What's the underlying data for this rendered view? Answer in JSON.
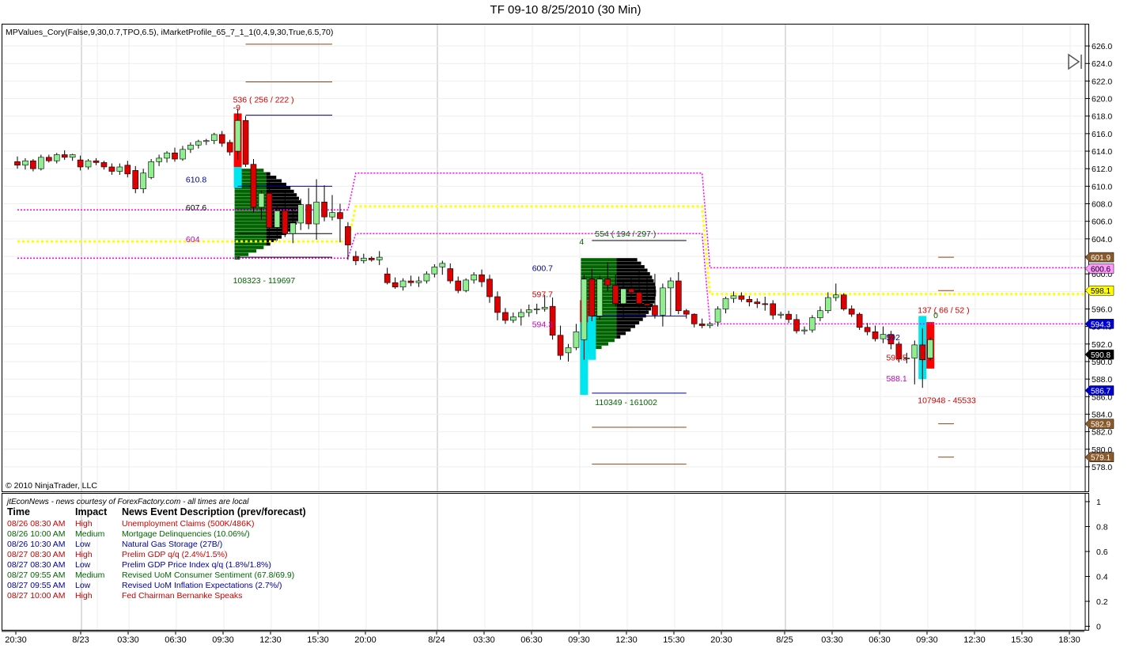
{
  "title": "TF 09-10  8/25/2010 (30 Min)",
  "indicator_label": "MPValues_Cory(False,9,30,0.7,TPO,6.5), iMarketProfile_65_7_1_1(0,4,9,30,True,6.5,70)",
  "copyright": "© 2010 NinjaTrader, LLC",
  "news": {
    "source": "jtEconNews - news courtesy of ForexFactory.com - all times are local",
    "headers": {
      "time": "Time",
      "impact": "Impact",
      "desc": "News Event Description (prev/forecast)"
    },
    "rows": [
      {
        "time": "08/26 08:30 AM",
        "impact": "High",
        "desc": "Unemployment Claims (500K/486K)",
        "color": "#cc0000"
      },
      {
        "time": "08/26 10:00 AM",
        "impact": "Medium",
        "desc": "Mortgage Delinquencies (10.06%/)",
        "color": "#006600"
      },
      {
        "time": "08/26 10:30 AM",
        "impact": "Low",
        "desc": "Natural Gas Storage (27B/)",
        "color": "#000099"
      },
      {
        "time": "08/27 08:30 AM",
        "impact": "High",
        "desc": "Prelim GDP q/q (2.4%/1.5%)",
        "color": "#cc0000"
      },
      {
        "time": "08/27 08:30 AM",
        "impact": "Low",
        "desc": "Prelim GDP Price Index q/q (1.8%/1.8%)",
        "color": "#000099"
      },
      {
        "time": "08/27 09:55 AM",
        "impact": "Medium",
        "desc": "Revised UoM Consumer Sentiment (67.8/69.9)",
        "color": "#006600"
      },
      {
        "time": "08/27 09:55 AM",
        "impact": "Low",
        "desc": "Revised UoM Inflation Expectations (2.7%/)",
        "color": "#000099"
      },
      {
        "time": "08/27 10:00 AM",
        "impact": "High",
        "desc": "Fed Chairman Bernanke Speaks",
        "color": "#cc0000"
      }
    ]
  },
  "chart_data": {
    "type": "candlestick",
    "title": "TF 09-10  8/25/2010 (30 Min)",
    "y_ticks": [
      "626.0",
      "624.0",
      "622.0",
      "620.0",
      "618.0",
      "616.0",
      "614.0",
      "612.0",
      "610.0",
      "608.0",
      "606.0",
      "604.0",
      "602.0",
      "600.0",
      "598.0",
      "596.0",
      "594.0",
      "592.0",
      "590.0",
      "588.0",
      "586.0",
      "584.0",
      "582.0",
      "580.0",
      "578.0"
    ],
    "ylim": [
      577,
      627
    ],
    "x_ticks": [
      "20:30",
      "8/23",
      "03:30",
      "06:30",
      "09:30",
      "12:30",
      "15:30",
      "20:00",
      "8/24",
      "03:30",
      "06:30",
      "09:30",
      "12:30",
      "15:30",
      "20:30",
      "8/25",
      "03:30",
      "06:30",
      "09:30",
      "12:30",
      "15:30",
      "18:30"
    ],
    "sub_ticks": [
      "1",
      "0.8",
      "0.6",
      "0.4",
      "0.2",
      "0"
    ],
    "candles": [
      [
        612.8,
        613.4,
        612.0,
        612.4
      ],
      [
        612.4,
        613.2,
        611.9,
        612.9
      ],
      [
        612.9,
        613.1,
        611.7,
        612.0
      ],
      [
        612.0,
        613.6,
        611.8,
        613.3
      ],
      [
        613.3,
        613.6,
        612.7,
        612.9
      ],
      [
        612.9,
        613.8,
        612.6,
        613.6
      ],
      [
        613.6,
        614.1,
        613.0,
        613.3
      ],
      [
        613.3,
        613.7,
        612.9,
        613.6
      ],
      [
        613.0,
        613.5,
        611.8,
        612.2
      ],
      [
        612.2,
        613.1,
        611.9,
        612.9
      ],
      [
        612.9,
        613.2,
        612.4,
        612.7
      ],
      [
        612.7,
        612.9,
        611.9,
        612.2
      ],
      [
        612.2,
        612.6,
        611.3,
        611.7
      ],
      [
        611.7,
        612.6,
        611.3,
        612.2
      ],
      [
        612.4,
        612.9,
        611.0,
        611.4
      ],
      [
        611.8,
        612.3,
        609.2,
        609.7
      ],
      [
        609.7,
        612.0,
        609.2,
        611.5
      ],
      [
        611.0,
        613.1,
        610.8,
        612.8
      ],
      [
        612.8,
        613.6,
        612.3,
        613.2
      ],
      [
        613.2,
        614.0,
        612.7,
        613.8
      ],
      [
        613.8,
        614.4,
        612.8,
        613.1
      ],
      [
        613.1,
        614.6,
        612.9,
        614.2
      ],
      [
        614.2,
        615.0,
        613.8,
        614.7
      ],
      [
        614.7,
        615.3,
        614.3,
        615.1
      ],
      [
        615.1,
        615.4,
        614.7,
        615.2
      ],
      [
        615.2,
        616.1,
        614.8,
        615.9
      ],
      [
        615.9,
        616.3,
        614.5,
        614.9
      ],
      [
        615.0,
        615.3,
        613.5,
        613.9
      ],
      [
        614.0,
        618.8,
        613.0,
        617.5
      ],
      [
        617.5,
        618.0,
        612.2,
        612.5
      ],
      [
        612.5,
        613.1,
        607.0,
        607.6
      ],
      [
        607.6,
        609.5,
        606.2,
        609.2
      ],
      [
        609.2,
        610.5,
        604.0,
        605.3
      ],
      [
        605.3,
        608.0,
        603.8,
        607.2
      ],
      [
        607.2,
        609.4,
        604.2,
        604.6
      ],
      [
        604.6,
        607.5,
        603.5,
        605.8
      ],
      [
        605.8,
        608.6,
        605.0,
        607.9
      ],
      [
        607.9,
        609.8,
        605.1,
        605.7
      ],
      [
        605.7,
        610.8,
        603.9,
        608.2
      ],
      [
        608.2,
        610.1,
        606.0,
        606.5
      ],
      [
        606.5,
        609.0,
        606.1,
        607.0
      ],
      [
        607.0,
        608.0,
        603.6,
        606.3
      ],
      [
        605.4,
        605.9,
        601.6,
        603.3
      ],
      [
        602.0,
        602.6,
        601.0,
        601.5
      ],
      [
        601.5,
        602.3,
        601.2,
        601.8
      ],
      [
        601.8,
        602.0,
        601.4,
        601.6
      ],
      [
        601.6,
        602.6,
        601.0,
        601.9
      ],
      [
        600.0,
        600.7,
        598.8,
        599.0
      ],
      [
        599.0,
        599.6,
        598.3,
        598.5
      ],
      [
        598.5,
        599.5,
        598.1,
        599.2
      ],
      [
        599.2,
        599.8,
        598.6,
        599.0
      ],
      [
        599.0,
        599.7,
        598.5,
        599.2
      ],
      [
        599.2,
        600.3,
        598.9,
        600.0
      ],
      [
        600.0,
        601.1,
        599.6,
        600.8
      ],
      [
        600.8,
        601.5,
        599.9,
        601.2
      ],
      [
        600.6,
        601.2,
        598.9,
        599.2
      ],
      [
        599.2,
        599.7,
        597.8,
        598.1
      ],
      [
        598.1,
        599.5,
        597.9,
        599.3
      ],
      [
        599.3,
        600.2,
        598.9,
        599.9
      ],
      [
        599.9,
        600.5,
        598.5,
        599.1
      ],
      [
        599.4,
        599.9,
        596.7,
        597.4
      ],
      [
        597.4,
        598.0,
        594.7,
        595.6
      ],
      [
        595.6,
        596.1,
        594.3,
        594.7
      ],
      [
        594.7,
        595.6,
        594.4,
        595.1
      ],
      [
        595.1,
        596.0,
        594.1,
        595.6
      ],
      [
        595.6,
        596.5,
        595.1,
        595.9
      ],
      [
        595.9,
        596.6,
        595.4,
        596.0
      ],
      [
        596.0,
        597.6,
        595.7,
        596.2
      ],
      [
        596.3,
        597.3,
        592.5,
        593.0
      ],
      [
        593.0,
        594.1,
        590.2,
        590.7
      ],
      [
        591.0,
        592.0,
        590.0,
        591.6
      ],
      [
        591.6,
        594.3,
        591.3,
        593.4
      ],
      [
        592.5,
        599.9,
        590.2,
        599.4
      ],
      [
        599.4,
        600.6,
        594.6,
        595.2
      ],
      [
        595.2,
        599.8,
        594.8,
        599.4
      ],
      [
        599.4,
        601.3,
        598.0,
        598.7
      ],
      [
        598.7,
        599.9,
        596.3,
        596.6
      ],
      [
        596.6,
        599.2,
        594.9,
        598.3
      ],
      [
        598.3,
        599.6,
        597.2,
        597.9
      ],
      [
        597.9,
        600.4,
        595.4,
        596.6
      ],
      [
        596.6,
        599.7,
        595.8,
        596.4
      ],
      [
        596.4,
        600.0,
        594.9,
        595.3
      ],
      [
        595.3,
        598.9,
        594.0,
        598.4
      ],
      [
        598.4,
        599.6,
        595.2,
        599.2
      ],
      [
        599.2,
        600.2,
        595.4,
        595.8
      ],
      [
        595.8,
        596.0,
        594.9,
        595.4
      ],
      [
        595.4,
        595.5,
        593.9,
        594.3
      ],
      [
        594.3,
        594.9,
        593.8,
        594.1
      ],
      [
        594.1,
        594.5,
        593.8,
        594.3
      ],
      [
        594.5,
        596.3,
        594.0,
        596.0
      ],
      [
        596.0,
        597.4,
        595.5,
        597.2
      ],
      [
        597.2,
        598.0,
        596.7,
        597.5
      ],
      [
        597.5,
        597.9,
        596.8,
        597.1
      ],
      [
        597.1,
        597.5,
        596.3,
        596.8
      ],
      [
        596.8,
        597.2,
        596.1,
        596.6
      ],
      [
        596.6,
        597.4,
        595.8,
        596.5
      ],
      [
        596.6,
        597.0,
        594.8,
        595.3
      ],
      [
        595.3,
        595.7,
        594.9,
        595.4
      ],
      [
        595.4,
        595.8,
        594.4,
        594.8
      ],
      [
        594.8,
        595.4,
        593.2,
        593.5
      ],
      [
        593.5,
        594.0,
        593.1,
        593.6
      ],
      [
        593.6,
        595.3,
        593.3,
        595.0
      ],
      [
        595.0,
        596.3,
        594.6,
        595.8
      ],
      [
        595.8,
        597.9,
        595.5,
        597.3
      ],
      [
        597.3,
        598.9,
        596.9,
        597.6
      ],
      [
        597.6,
        597.8,
        595.8,
        596.0
      ],
      [
        596.0,
        596.4,
        595.1,
        595.4
      ],
      [
        595.4,
        595.6,
        593.6,
        593.9
      ],
      [
        593.9,
        594.4,
        593.0,
        593.4
      ],
      [
        593.4,
        594.1,
        592.3,
        592.6
      ],
      [
        592.6,
        594.0,
        592.1,
        593.1
      ],
      [
        593.1,
        593.5,
        591.4,
        592.0
      ],
      [
        592.0,
        592.3,
        589.9,
        590.3
      ],
      [
        590.3,
        591.0,
        589.8,
        590.4
      ],
      [
        590.4,
        592.4,
        587.4,
        591.9
      ],
      [
        591.9,
        593.8,
        587.0,
        590.2
      ],
      [
        590.4,
        592.8,
        590.1,
        592.5
      ]
    ],
    "lines": [
      {
        "name": "upper band",
        "color": "#ff00ff",
        "style": "dotted",
        "values": [
          [
            0,
            607.3
          ],
          [
            42,
            607.3
          ],
          [
            43,
            611.5
          ],
          [
            87,
            611.5
          ],
          [
            88,
            600.7
          ],
          [
            122,
            600.7
          ]
        ]
      },
      {
        "name": "value area",
        "color": "#ffff00",
        "style": "dotted",
        "values": [
          [
            0,
            603.7
          ],
          [
            42,
            603.7
          ],
          [
            43,
            607.7
          ],
          [
            87,
            607.7
          ],
          [
            88,
            597.7
          ],
          [
            122,
            597.7
          ]
        ]
      },
      {
        "name": "lower band",
        "color": "#ff00ff",
        "style": "dotted",
        "values": [
          [
            0,
            601.8
          ],
          [
            42,
            601.8
          ],
          [
            43,
            604.6
          ],
          [
            87,
            604.6
          ],
          [
            88,
            594.3
          ],
          [
            122,
            594.3
          ]
        ]
      }
    ],
    "labels": [
      {
        "text": "536 ( 256 / 222 )",
        "color": "#cc0000",
        "price": 619.9,
        "bar": 28
      },
      {
        "text": "-9",
        "color": "#cc0000",
        "price": 619.0,
        "bar": 28
      },
      {
        "text": "610.8",
        "color": "#000099",
        "price": 610.8,
        "bar": 22
      },
      {
        "text": "607.6",
        "color": "#000000",
        "price": 607.6,
        "bar": 22
      },
      {
        "text": "604",
        "color": "#cc00cc",
        "price": 604.0,
        "bar": 22
      },
      {
        "text": "108323 - 119697",
        "color": "#006600",
        "price": 599.3,
        "bar": 28
      },
      {
        "text": "554 ( 194 / 297 )",
        "color": "#006600",
        "price": 604.6,
        "bar": 74
      },
      {
        "text": "4",
        "color": "#006600",
        "price": 603.7,
        "bar": 72
      },
      {
        "text": "600.7",
        "color": "#000099",
        "price": 600.7,
        "bar": 66
      },
      {
        "text": "597.7",
        "color": "#cc0000",
        "price": 597.7,
        "bar": 66
      },
      {
        "text": "594.3",
        "color": "#cc00cc",
        "price": 594.3,
        "bar": 66
      },
      {
        "text": "110349 - 161002",
        "color": "#006600",
        "price": 585.4,
        "bar": 74
      },
      {
        "text": "137 ( 66 / 52 )",
        "color": "#cc0000",
        "price": 595.9,
        "bar": 115
      },
      {
        "text": "0",
        "color": "#006600",
        "price": 595.3,
        "bar": 117
      },
      {
        "text": "592",
        "color": "#000099",
        "price": 592.8,
        "bar": 111
      },
      {
        "text": "590.5",
        "color": "#cc0000",
        "price": 590.5,
        "bar": 111
      },
      {
        "text": "588.1",
        "color": "#cc00cc",
        "price": 588.1,
        "bar": 111
      },
      {
        "text": "107948 - 45533",
        "color": "#cc0000",
        "price": 585.6,
        "bar": 115
      }
    ],
    "price_markers": [
      {
        "text": "601.9",
        "price": 601.9,
        "bg": "#8b5a2b",
        "fg": "#ffffff"
      },
      {
        "text": "600.6",
        "price": 600.6,
        "bg": "#ff99ff",
        "fg": "#000000"
      },
      {
        "text": "598.1",
        "price": 598.1,
        "bg": "#ffff00",
        "fg": "#000000"
      },
      {
        "text": "594.3",
        "price": 594.3,
        "bg": "#0000cc",
        "fg": "#ffffff"
      },
      {
        "text": "590.8",
        "price": 590.8,
        "bg": "#000000",
        "fg": "#ffffff"
      },
      {
        "text": "586.7",
        "price": 586.7,
        "bg": "#0000cc",
        "fg": "#ffffff"
      },
      {
        "text": "582.9",
        "price": 582.9,
        "bg": "#8b5a2b",
        "fg": "#ffffff"
      },
      {
        "text": "579.1",
        "price": 579.1,
        "bg": "#8b5a2b",
        "fg": "#ffffff"
      }
    ]
  }
}
